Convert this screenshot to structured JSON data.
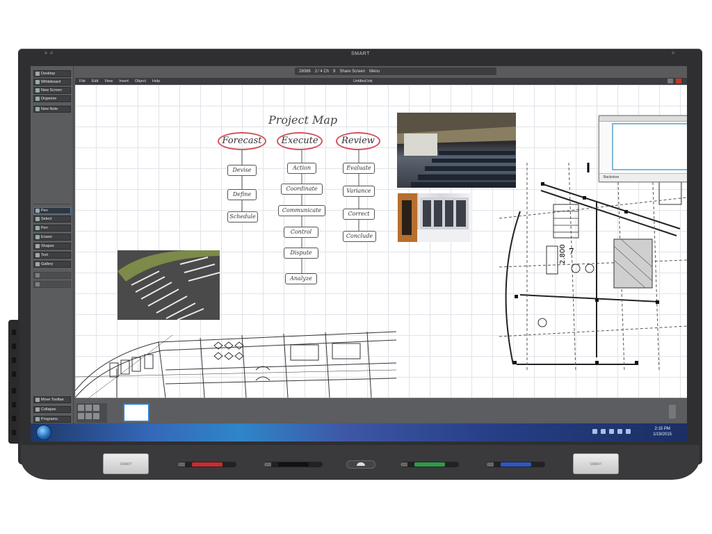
{
  "device": {
    "brand": "SMART",
    "tray_left_label": "SMART",
    "tray_right_label": "SMART"
  },
  "floating_toolbar": {
    "items": [
      "28086",
      "2 ⁄ 4 Ch",
      "9",
      "Share Screen",
      "Menu"
    ]
  },
  "sidebar": {
    "top_items": [
      {
        "label": "Desktop",
        "icon": "desktop-icon"
      },
      {
        "label": "Whiteboard",
        "icon": "whiteboard-icon"
      },
      {
        "label": "New Screen",
        "icon": "new-screen-icon"
      },
      {
        "label": "Organize",
        "icon": "organize-icon"
      },
      {
        "label": "New Note",
        "icon": "note-icon"
      }
    ],
    "tool_items": [
      {
        "label": "Pen",
        "icon": "pen-icon"
      },
      {
        "label": "Select",
        "icon": "select-icon"
      },
      {
        "label": "Pen",
        "icon": "pen-type-icon"
      },
      {
        "label": "Eraser",
        "icon": "eraser-icon"
      },
      {
        "label": "Shapes",
        "icon": "shapes-icon"
      },
      {
        "label": "Text",
        "icon": "text-icon"
      },
      {
        "label": "Gallery",
        "icon": "gallery-icon"
      }
    ],
    "bottom_items": [
      {
        "label": "Move Toolbar",
        "icon": "move-icon"
      },
      {
        "label": "Collapse",
        "icon": "collapse-icon"
      },
      {
        "label": "Programs",
        "icon": "programs-icon"
      }
    ]
  },
  "app": {
    "menus": [
      "File",
      "Edit",
      "View",
      "Insert",
      "Object",
      "Help"
    ],
    "window_title": "Untitled.Ink"
  },
  "board": {
    "title": "Project Map",
    "columns": [
      {
        "header": "Forecast",
        "nodes": [
          "Devise",
          "Define",
          "Schedule"
        ]
      },
      {
        "header": "Execute",
        "nodes": [
          "Action",
          "Coordinate",
          "Communicate",
          "Control",
          "Dispute",
          "Analyze"
        ]
      },
      {
        "header": "Review",
        "nodes": [
          "Evaluate",
          "Variance",
          "Correct",
          "Conclude"
        ]
      }
    ],
    "plan_labels": [
      "2.800",
      "7",
      "C"
    ]
  },
  "mini_window": {
    "footer": "Backstore"
  },
  "taskbar": {
    "time": "2:15 PM",
    "date": "1/19/2015"
  }
}
